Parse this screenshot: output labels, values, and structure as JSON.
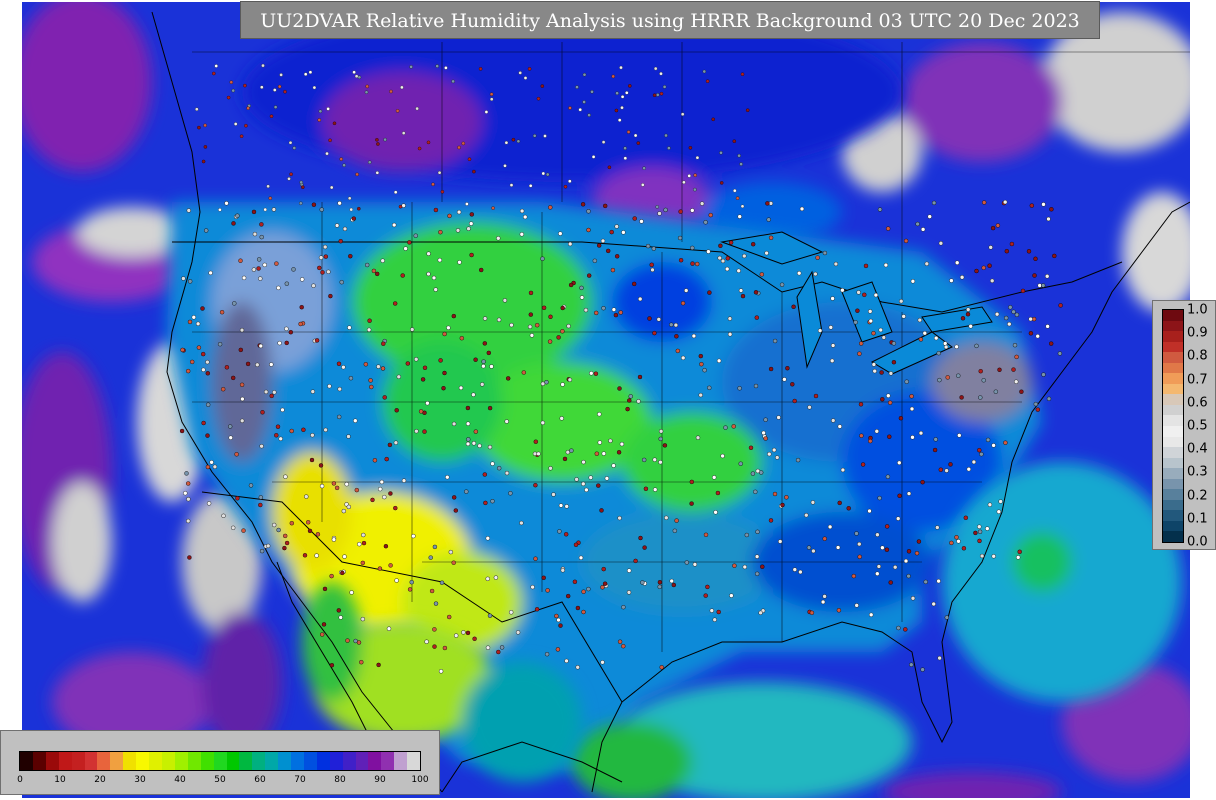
{
  "title": "UU2DVAR Relative Humidity Analysis using HRRR Background 03 UTC 20 Dec 2023",
  "rh_colorbar": {
    "ticks": [
      "0",
      "10",
      "20",
      "30",
      "40",
      "50",
      "60",
      "70",
      "80",
      "90",
      "100"
    ],
    "colors": [
      "#200000",
      "#5a0000",
      "#9a0a0a",
      "#c01818",
      "#c42020",
      "#d23232",
      "#e8643c",
      "#f0a040",
      "#f0e000",
      "#f8f800",
      "#e0f000",
      "#c8f000",
      "#a0f000",
      "#70e800",
      "#40e000",
      "#20d820",
      "#00c800",
      "#00b840",
      "#00b080",
      "#00a8a8",
      "#0090d0",
      "#0070e0",
      "#0050e0",
      "#0030e0",
      "#2020d8",
      "#4020c8",
      "#6020b8",
      "#8010a0",
      "#9030b0",
      "#c0a0d0",
      "#d8d8d8"
    ]
  },
  "ob_colorbar": {
    "ticks": [
      "1.0",
      "0.9",
      "0.8",
      "0.7",
      "0.6",
      "0.5",
      "0.4",
      "0.3",
      "0.2",
      "0.1",
      "0.0"
    ],
    "colors": [
      "#6e0a10",
      "#8c1418",
      "#a8201c",
      "#c03028",
      "#d05a40",
      "#e07848",
      "#f09c58",
      "#f4b870",
      "#d8c8b8",
      "#d0d0d0",
      "#e4e4e4",
      "#f0f0f0",
      "#e8e8e8",
      "#d0d4d8",
      "#b8c4cc",
      "#98acbc",
      "#7894ac",
      "#58809c",
      "#3a6c8c",
      "#22587c",
      "#0e4468",
      "#04304c"
    ]
  },
  "map": {
    "fill_colors": {
      "ocean": "#1a32d8",
      "gulf": "#20c0b0",
      "atlantic": "#18b0d0",
      "dry_sw": "#f0f000",
      "plains_green": "#30d040",
      "moist_blue": "#0060e0",
      "cloud_gray": "#d0d0d0",
      "purple": "#7020b0"
    }
  }
}
